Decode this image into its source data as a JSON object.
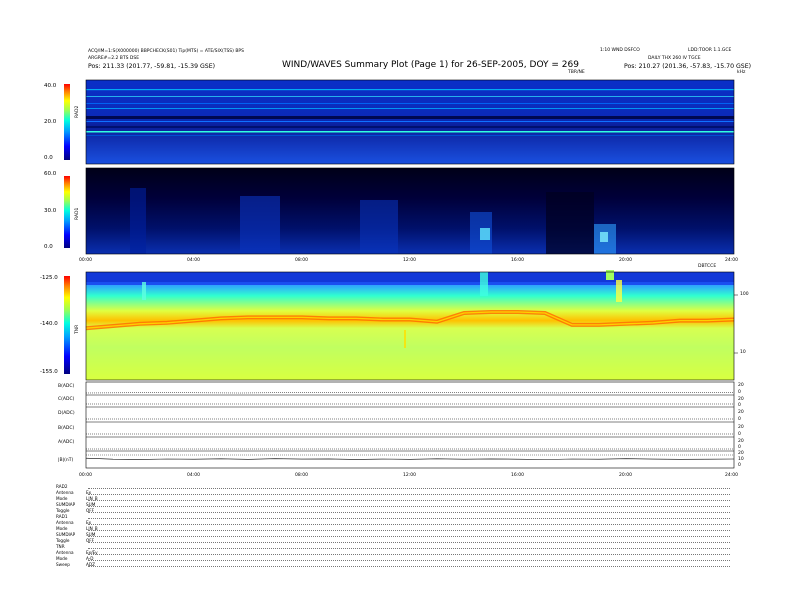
{
  "header": {
    "title": "WIND/WAVES Summary Plot (Page 1) for 26-SEP-2005, DOY = 269",
    "left_top_1": "ACQ/IM=1:S(X000000) BBPCHECK(S01) Tip(MTS) = ATE/SIX(TSS) BPS",
    "left_top_2": "ARGRE#=2.2 BTS DSE",
    "left_pos": "Pos:   211.33 (201.77, -59.81, -15.39 GSE)",
    "right_top_1": "1:10 WND DSFCO",
    "right_top_2": "LDD:TOOR 1.1.GCE",
    "right_top_3": "DAILY THX 260 IV TGCE",
    "right_pos": "Pos:   210.27 (201.36, -57.83, -15.70 GSE)",
    "mid_tag": "TBR/NE",
    "right_unit": "kHz"
  },
  "chart_data": [
    {
      "type": "heatmap",
      "panel": "RAD2",
      "ylabel": "RAD2",
      "y_ticks": [
        "40.0",
        "20.0",
        "0.0"
      ],
      "ylim": [
        0,
        40
      ],
      "colormap": [
        "#00007f",
        "#0000ff",
        "#00a0ff",
        "#00ffe0",
        "#a0ff50",
        "#ffff00",
        "#ff8000",
        "#ff0000"
      ],
      "description_bands": "persistent narrowband emission lines in upper half"
    },
    {
      "type": "heatmap",
      "panel": "RAD1",
      "ylabel": "RAD1",
      "y_ticks": [
        "60.0",
        "30.0",
        "0.0"
      ],
      "ylim": [
        0,
        60
      ],
      "x_ticks": [
        "00:00",
        "04:00",
        "08:00",
        "12:00",
        "16:00",
        "20:00",
        "24:00"
      ],
      "x_tag": "DBTCCE"
    },
    {
      "type": "heatmap",
      "panel": "TNR",
      "ylabel": "TNR",
      "y_ticks": [
        "-125.0",
        "-140.0",
        "-155.0"
      ],
      "ylim": [
        -155,
        -125
      ],
      "right_ticks": [
        "100",
        "10"
      ],
      "plasma_line": [
        {
          "t": 0,
          "level": 0.52
        },
        {
          "t": 1,
          "level": 0.5
        },
        {
          "t": 2,
          "level": 0.48
        },
        {
          "t": 3,
          "level": 0.47
        },
        {
          "t": 4,
          "level": 0.45
        },
        {
          "t": 5,
          "level": 0.43
        },
        {
          "t": 6,
          "level": 0.42
        },
        {
          "t": 7,
          "level": 0.42
        },
        {
          "t": 8,
          "level": 0.42
        },
        {
          "t": 9,
          "level": 0.43
        },
        {
          "t": 10,
          "level": 0.43
        },
        {
          "t": 11,
          "level": 0.44
        },
        {
          "t": 12,
          "level": 0.44
        },
        {
          "t": 13,
          "level": 0.46
        },
        {
          "t": 14,
          "level": 0.38
        },
        {
          "t": 15,
          "level": 0.37
        },
        {
          "t": 16,
          "level": 0.37
        },
        {
          "t": 17,
          "level": 0.38
        },
        {
          "t": 18,
          "level": 0.49
        },
        {
          "t": 19,
          "level": 0.49
        },
        {
          "t": 20,
          "level": 0.48
        },
        {
          "t": 21,
          "level": 0.47
        },
        {
          "t": 22,
          "level": 0.45
        },
        {
          "t": 23,
          "level": 0.45
        },
        {
          "t": 24,
          "level": 0.44
        }
      ]
    },
    {
      "type": "line",
      "panels": [
        {
          "label": "B(ADC)",
          "right": [
            "20",
            "0"
          ]
        },
        {
          "label": "C(ADC)",
          "right": [
            "20",
            "0"
          ]
        },
        {
          "label": "D(ADC)",
          "right": [
            "20",
            "0"
          ]
        },
        {
          "label": "B(ADC)",
          "right": [
            "20",
            "0"
          ]
        },
        {
          "label": "A(ADC)",
          "right": [
            "20",
            "0"
          ]
        },
        {
          "label": "|B|(nT)",
          "right": [
            "20",
            "10",
            "0"
          ]
        }
      ],
      "x_ticks": [
        "00:00",
        "04:00",
        "08:00",
        "12:00",
        "16:00",
        "20:00",
        "24:00"
      ],
      "bmag_series": [
        {
          "t": 0,
          "v": 11.5
        },
        {
          "t": 1,
          "v": 10.4
        },
        {
          "t": 2,
          "v": 10.1
        },
        {
          "t": 3,
          "v": 10.6
        },
        {
          "t": 4,
          "v": 10.3
        },
        {
          "t": 5,
          "v": 10.8
        },
        {
          "t": 6,
          "v": 10.2
        },
        {
          "t": 7,
          "v": 10.9
        },
        {
          "t": 8,
          "v": 10.5
        },
        {
          "t": 9,
          "v": 10.7
        },
        {
          "t": 10,
          "v": 10.1
        },
        {
          "t": 11,
          "v": 10.6
        },
        {
          "t": 12,
          "v": 10.2
        },
        {
          "t": 13,
          "v": 10.8
        },
        {
          "t": 14,
          "v": 10.4
        },
        {
          "t": 15,
          "v": 10.7
        },
        {
          "t": 16,
          "v": 10.3
        },
        {
          "t": 17,
          "v": 10.0
        },
        {
          "t": 18,
          "v": 10.6
        },
        {
          "t": 19,
          "v": 10.4
        },
        {
          "t": 20,
          "v": 10.9
        },
        {
          "t": 21,
          "v": 10.5
        },
        {
          "t": 22,
          "v": 10.2
        },
        {
          "t": 23,
          "v": 10.4
        },
        {
          "t": 24,
          "v": 10.6
        }
      ]
    }
  ],
  "footer": [
    {
      "label": "RAD2",
      "value": ""
    },
    {
      "label": "Antenna",
      "value": "Ex"
    },
    {
      "label": "Mode",
      "value": "LIN_B"
    },
    {
      "label": "SUMDIAP",
      "value": "SUM"
    },
    {
      "label": "Toggle",
      "value": "OFF"
    },
    {
      "label": "RAD1",
      "value": ""
    },
    {
      "label": "Antenna",
      "value": "Ex"
    },
    {
      "label": "Mode",
      "value": "LIN_B"
    },
    {
      "label": "SUMDIAP",
      "value": "SUM"
    },
    {
      "label": "Toggle",
      "value": "OFF"
    },
    {
      "label": "TNR",
      "value": ""
    },
    {
      "label": "Antenna",
      "value": "Ex/Ey"
    },
    {
      "label": "Mode",
      "value": "A-D"
    },
    {
      "label": "Sweep",
      "value": "ADZ"
    }
  ]
}
